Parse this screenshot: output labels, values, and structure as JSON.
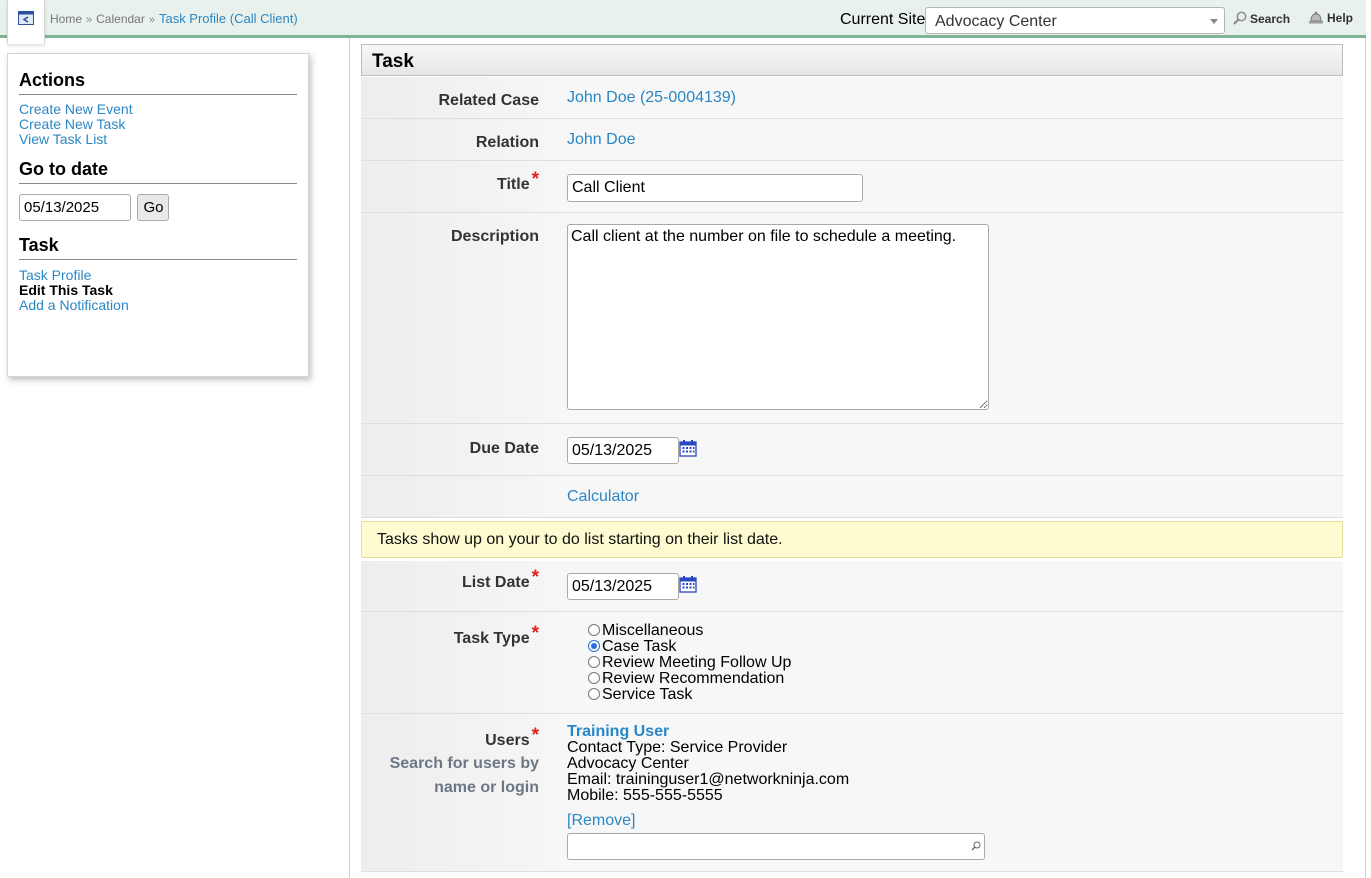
{
  "header": {
    "breadcrumb": [
      "Home",
      "Calendar",
      "Task Profile (Call Client)"
    ],
    "breadcrumb_sep": "»",
    "current_site_label": "Current Site",
    "current_site_value": "Advocacy Center",
    "search_label": "Search",
    "help_label": "Help"
  },
  "sidebar": {
    "actions_title": "Actions",
    "actions": [
      "Create New Event",
      "Create New Task",
      "View Task List"
    ],
    "goto_title": "Go to date",
    "goto_value": "05/13/2025",
    "goto_button": "Go",
    "task_title": "Task",
    "task_links": [
      "Task Profile",
      "Edit This Task",
      "Add a Notification"
    ]
  },
  "form": {
    "title": "Task",
    "related_case_label": "Related Case",
    "related_case_value": "John Doe (25-0004139)",
    "relation_label": "Relation",
    "relation_value": "John Doe",
    "title_label": "Title",
    "title_value": "Call Client",
    "description_label": "Description",
    "description_value": "Call client at the number on file to schedule a meeting.",
    "due_date_label": "Due Date",
    "due_date_value": "05/13/2025",
    "calculator_label": "Calculator",
    "notice": "Tasks show up on your to do list starting on their list date.",
    "list_date_label": "List Date",
    "list_date_value": "05/13/2025",
    "task_type_label": "Task Type",
    "task_types": [
      "Miscellaneous",
      "Case Task",
      "Review Meeting Follow Up",
      "Review Recommendation",
      "Service Task"
    ],
    "task_type_selected": "Case Task",
    "users_label": "Users",
    "users_hint_line1": "Search for users by",
    "users_hint_line2": "name or login",
    "user": {
      "name": "Training User",
      "contact_type": "Contact Type: Service Provider",
      "organization": "Advocacy Center",
      "email": "Email: traininguser1@networkninja.com",
      "mobile": "Mobile: 555-555-5555",
      "remove_label": "[Remove]"
    },
    "required_mark": "*"
  }
}
